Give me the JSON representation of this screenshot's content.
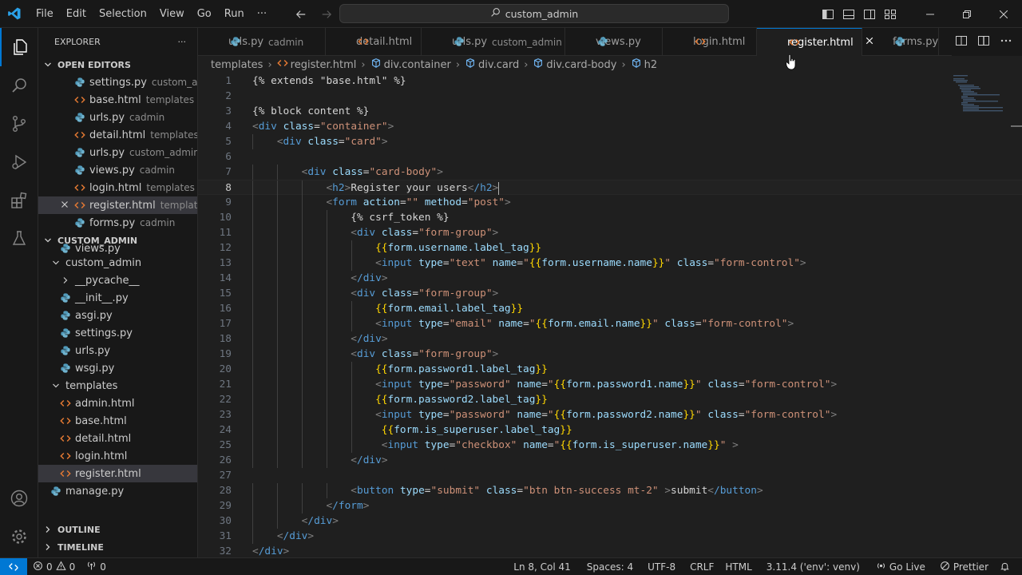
{
  "titlebar": {
    "menu": [
      "File",
      "Edit",
      "Selection",
      "View",
      "Go",
      "Run",
      "···"
    ],
    "search_text": "custom_admin"
  },
  "sidebar": {
    "header": "EXPLORER",
    "more": "···",
    "open_editors_title": "OPEN EDITORS",
    "open_editors": [
      {
        "name": "settings.py",
        "desc": "custom_ad...",
        "icon": "python"
      },
      {
        "name": "base.html",
        "desc": "templates",
        "icon": "html"
      },
      {
        "name": "urls.py",
        "desc": "cadmin",
        "icon": "python"
      },
      {
        "name": "detail.html",
        "desc": "templates",
        "icon": "html"
      },
      {
        "name": "urls.py",
        "desc": "custom_admin",
        "icon": "python"
      },
      {
        "name": "views.py",
        "desc": "cadmin",
        "icon": "python"
      },
      {
        "name": "login.html",
        "desc": "templates",
        "icon": "html"
      },
      {
        "name": "register.html",
        "desc": "templates",
        "icon": "html",
        "selected": true
      },
      {
        "name": "forms.py",
        "desc": "cadmin",
        "icon": "python"
      }
    ],
    "project_title": "CUSTOM_ADMIN",
    "project_tree": [
      {
        "name": "views.py",
        "icon": "python",
        "indent": 1
      },
      {
        "name": "custom_admin",
        "icon": "folder-open",
        "indent": 0
      },
      {
        "name": "__pycache__",
        "icon": "folder-closed",
        "indent": 1
      },
      {
        "name": "__init__.py",
        "icon": "python",
        "indent": 1
      },
      {
        "name": "asgi.py",
        "icon": "python",
        "indent": 1
      },
      {
        "name": "settings.py",
        "icon": "python",
        "indent": 1
      },
      {
        "name": "urls.py",
        "icon": "python",
        "indent": 1
      },
      {
        "name": "wsgi.py",
        "icon": "python",
        "indent": 1
      },
      {
        "name": "templates",
        "icon": "folder-open",
        "indent": 0
      },
      {
        "name": "admin.html",
        "icon": "html",
        "indent": 1
      },
      {
        "name": "base.html",
        "icon": "html",
        "indent": 1
      },
      {
        "name": "detail.html",
        "icon": "html",
        "indent": 1
      },
      {
        "name": "login.html",
        "icon": "html",
        "indent": 1
      },
      {
        "name": "register.html",
        "icon": "html",
        "indent": 1,
        "selected": true
      },
      {
        "name": "manage.py",
        "icon": "python",
        "indent": 0
      }
    ],
    "outline_title": "OUTLINE",
    "timeline_title": "TIMELINE"
  },
  "tabs": [
    {
      "name": "urls.py",
      "desc": "cadmin",
      "icon": "python"
    },
    {
      "name": "detail.html",
      "desc": "",
      "icon": "html"
    },
    {
      "name": "urls.py",
      "desc": "custom_admin",
      "icon": "python"
    },
    {
      "name": "views.py",
      "desc": "",
      "icon": "python"
    },
    {
      "name": "login.html",
      "desc": "",
      "icon": "html"
    },
    {
      "name": "register.html",
      "desc": "",
      "icon": "html",
      "active": true
    },
    {
      "name": "forms.py",
      "desc": "",
      "icon": "python"
    }
  ],
  "breadcrumb": [
    "templates",
    "register.html",
    "div.container",
    "div.card",
    "div.card-body",
    "h2"
  ],
  "editor": {
    "current_line": 8,
    "lines": [
      "{% extends \"base.html\" %}",
      "",
      "{% block content %}",
      "<div class=\"container\">",
      "    <div class=\"card\">",
      "",
      "        <div class=\"card-body\">",
      "            <h2>Register your users</h2>",
      "            <form action=\"\" method=\"post\">",
      "                {% csrf_token %}",
      "                <div class=\"form-group\">",
      "                    {{form.username.label_tag}}",
      "                    <input type=\"text\" name=\"{{form.username.name}}\" class=\"form-control\">",
      "                </div>",
      "                <div class=\"form-group\">",
      "                    {{form.email.label_tag}}",
      "                    <input type=\"email\" name=\"{{form.email.name}}\" class=\"form-control\">",
      "                </div>",
      "                <div class=\"form-group\">",
      "                    {{form.password1.label_tag}}",
      "                    <input type=\"password\" name=\"{{form.password1.name}}\" class=\"form-control\">",
      "                    {{form.password2.label_tag}}",
      "                    <input type=\"password\" name=\"{{form.password2.name}}\" class=\"form-control\">",
      "                     {{form.is_superuser.label_tag}}",
      "                     <input type=\"checkbox\" name=\"{{form.is_superuser.name}}\" >",
      "                </div>",
      "",
      "                <button type=\"submit\" class=\"btn btn-success mt-2\" >submit</button>",
      "            </form>",
      "        </div>",
      "    </div>",
      "</div>"
    ]
  },
  "statusbar": {
    "errors": "0",
    "warnings": "0",
    "ports": "0",
    "position": "Ln 8, Col 41",
    "spaces": "Spaces: 4",
    "encoding": "UTF-8",
    "eol": "CRLF",
    "language": "HTML",
    "interpreter": "3.11.4 ('env': venv)",
    "golive": "Go Live",
    "prettier": "Prettier"
  },
  "colors": {
    "accent": "#0078d4",
    "python_icon": "#519aba",
    "html_icon": "#e37933"
  }
}
